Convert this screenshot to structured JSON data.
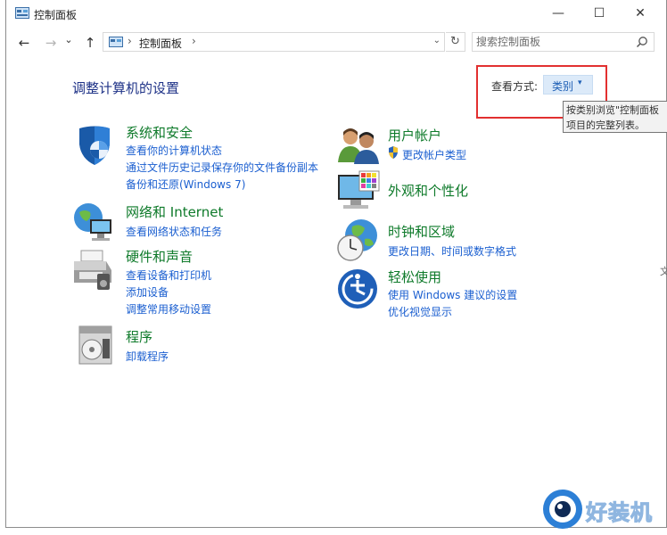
{
  "window": {
    "title": "控制面板",
    "minimize_label": "—",
    "maximize_label": "☐",
    "close_label": "✕"
  },
  "nav": {
    "back_label": "←",
    "forward_label": "→",
    "recent_label": "⌄",
    "up_label": "↑"
  },
  "address": {
    "separator": "›",
    "path_label": "控制面板",
    "trailing_separator": "›",
    "dropdown_label": "⌄",
    "refresh_label": "↻"
  },
  "search": {
    "placeholder": "搜索控制面板"
  },
  "main": {
    "heading": "调整计算机的设置",
    "view_by_label": "查看方式:",
    "view_by_value": "类别",
    "view_by_arrow": "▾",
    "tooltip_line1": "按类别浏览\"控制面板",
    "tooltip_line2": "项目的完整列表。"
  },
  "categories_left": [
    {
      "title": "系统和安全",
      "links": [
        "查看你的计算机状态",
        "通过文件历史记录保存你的文件备份副本",
        "备份和还原(Windows 7)"
      ]
    },
    {
      "title": "网络和 Internet",
      "links": [
        "查看网络状态和任务"
      ]
    },
    {
      "title": "硬件和声音",
      "links": [
        "查看设备和打印机",
        "添加设备",
        "调整常用移动设置"
      ]
    },
    {
      "title": "程序",
      "links": [
        "卸载程序"
      ]
    }
  ],
  "categories_right": [
    {
      "title": "用户帐户",
      "links": [
        "更改帐户类型"
      ]
    },
    {
      "title": "外观和个性化",
      "links": []
    },
    {
      "title": "时钟和区域",
      "links": [
        "更改日期、时间或数字格式"
      ]
    },
    {
      "title": "轻松使用",
      "links": [
        "使用 Windows 建议的设置",
        "优化视觉显示"
      ]
    }
  ],
  "watermark": {
    "text": "好装机"
  },
  "edge_glyph": "文",
  "colors": {
    "title_green": "#0e7a2a",
    "link_blue": "#1b5fd0",
    "heading_blue": "#1e3287",
    "highlight_red": "#e23030"
  },
  "icons": [
    "control-panel-icon",
    "search-icon",
    "shield-icon",
    "network-icon",
    "printer-icon",
    "programs-icon",
    "users-icon",
    "display-icon",
    "clock-globe-icon",
    "ease-of-access-icon",
    "uac-shield-icon"
  ]
}
